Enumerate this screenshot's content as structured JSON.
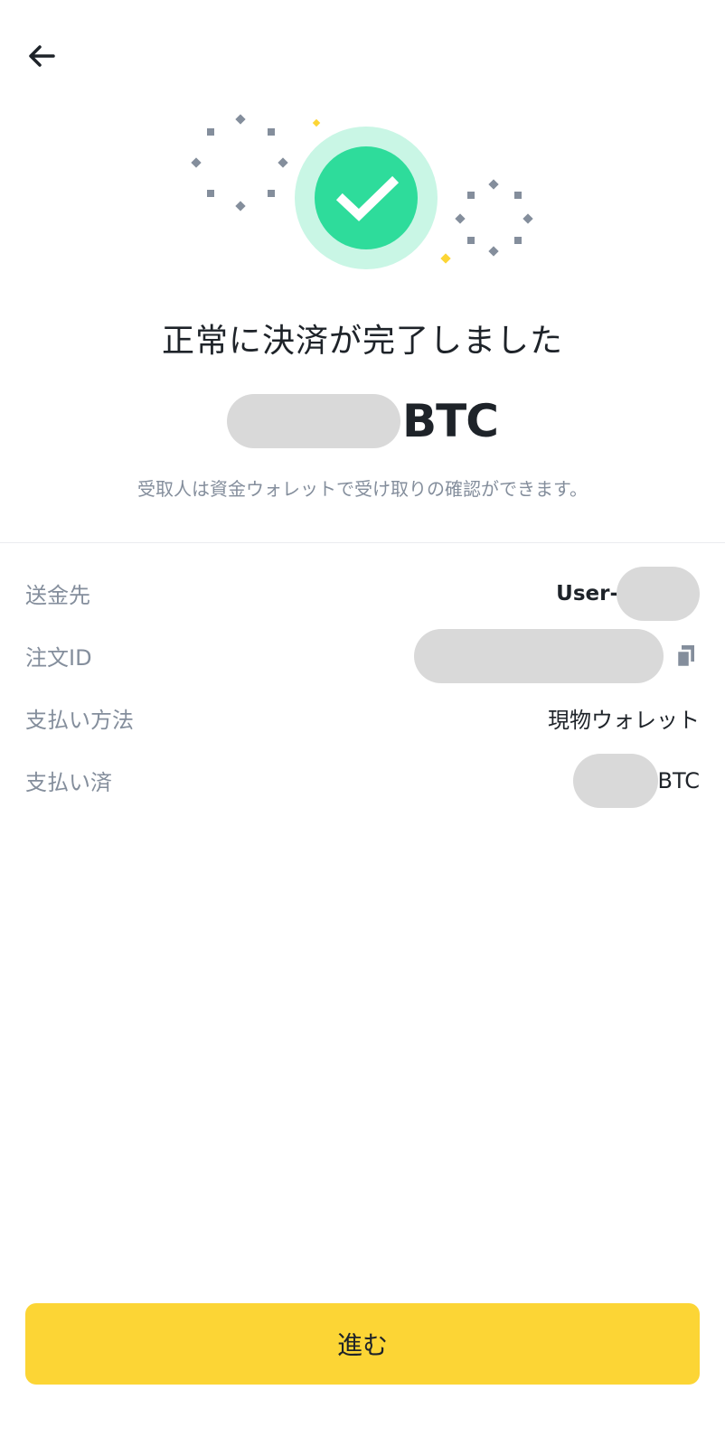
{
  "header": {
    "back_icon": "arrow-left-icon"
  },
  "hero": {
    "icon": "check-circle-icon",
    "accent": "#2edc9b",
    "halo": "#c9f6e5",
    "sparkle_gray": "#848e9c",
    "sparkle_yellow": "#fcd535"
  },
  "result": {
    "title": "正常に決済が完了しました",
    "amount_unit": "BTC",
    "subtitle": "受取人は資金ウォレットで受け取りの確認ができます。"
  },
  "details": {
    "recipient": {
      "label": "送金先",
      "value_prefix": "User-"
    },
    "order_id": {
      "label": "注文ID",
      "copy_icon": "copy-icon"
    },
    "payment_method": {
      "label": "支払い方法",
      "value": "現物ウォレット"
    },
    "paid": {
      "label": "支払い済",
      "unit": "BTC"
    }
  },
  "footer": {
    "continue_label": "進む",
    "button_color": "#fcd535"
  }
}
